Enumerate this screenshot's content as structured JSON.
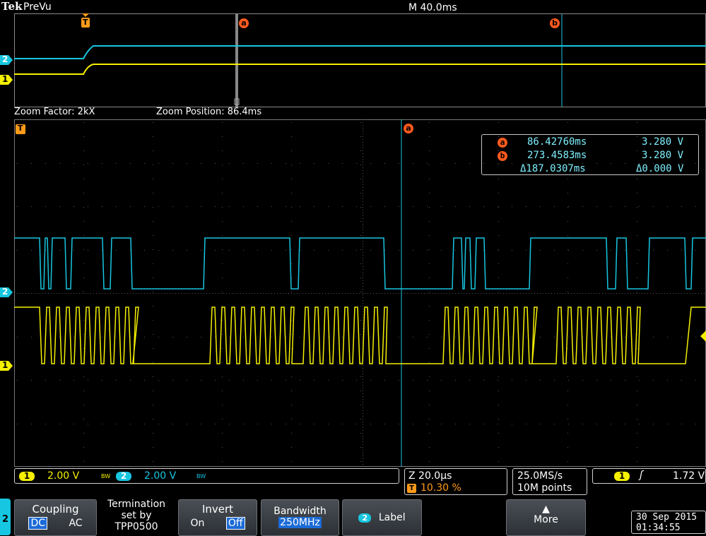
{
  "header": {
    "brand": "Tek",
    "mode": "PreVu",
    "timebase": "M 40.0ms"
  },
  "overview": {
    "trigger_marker": "T",
    "cursor_a": "a",
    "cursor_b": "b",
    "ch2_marker": "2",
    "ch1_marker": "1"
  },
  "zoom": {
    "factor": "Zoom Factor: 2kX",
    "position": "Zoom Position: 86.4ms"
  },
  "main": {
    "trigger_marker": "T",
    "cursor_a": "a",
    "ch2_marker": "2",
    "ch1_marker": "1"
  },
  "readout": {
    "a_badge": "a",
    "a_time": "86.42760ms",
    "a_volt": "3.280 V",
    "b_badge": "b",
    "b_time": "273.4583ms",
    "b_volt": "3.280 V",
    "delta_time": "Δ187.0307ms",
    "delta_volt": "Δ0.000 V"
  },
  "status": {
    "ch1_badge": "1",
    "ch1_scale": "2.00 V",
    "ch1_bw": "BW",
    "ch2_badge": "2",
    "ch2_scale": "2.00 V",
    "ch2_bw": "BW",
    "zoom_scale": "Z 20.0µs",
    "trig_badge": "T",
    "trig_pos": "10.30 %",
    "sample_rate": "25.0MS/s",
    "record_length": "10M points",
    "trig_src_badge": "1",
    "trig_slope": "ʃ",
    "trig_level": "1.72 V"
  },
  "menu": {
    "channel_tab": "2",
    "coupling_label": "Coupling",
    "coupling_dc": "DC",
    "coupling_ac": "AC",
    "termination_line1": "Termination",
    "termination_line2": "set by",
    "termination_line3": "TPP0500",
    "invert_label": "Invert",
    "invert_on": "On",
    "invert_off": "Off",
    "bandwidth_label": "Bandwidth",
    "bandwidth_value": "250MHz",
    "label_badge": "2",
    "label_text": "Label",
    "more_arrow": "▲",
    "more_label": "More",
    "date": "30 Sep  2015",
    "time": "01:34:55"
  },
  "colors": {
    "ch1": "#f5f000",
    "ch2": "#17c6e0",
    "cursor": "#ff5a1e",
    "trigger": "#ff9a1a"
  }
}
